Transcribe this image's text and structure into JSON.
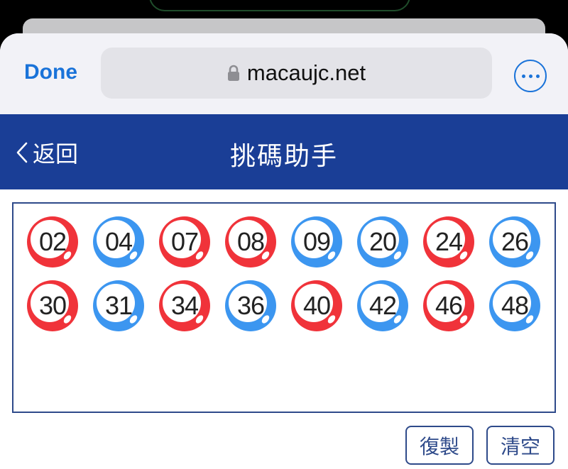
{
  "browser": {
    "done_label": "Done",
    "url": "macaujc.net",
    "lock_icon": "lock-icon",
    "more_icon": "ellipsis-circle-icon",
    "accent": "#1a73d9"
  },
  "nav": {
    "back_label": "返回",
    "back_icon": "chevron-left-icon",
    "title": "挑碼助手",
    "color": "#1a3e96"
  },
  "colors": {
    "red": "#f0333a",
    "blue": "#3c96f0"
  },
  "balls": [
    {
      "num": "02",
      "color": "red"
    },
    {
      "num": "04",
      "color": "blue"
    },
    {
      "num": "07",
      "color": "red"
    },
    {
      "num": "08",
      "color": "red"
    },
    {
      "num": "09",
      "color": "blue"
    },
    {
      "num": "20",
      "color": "blue"
    },
    {
      "num": "24",
      "color": "red"
    },
    {
      "num": "26",
      "color": "blue"
    },
    {
      "num": "30",
      "color": "red"
    },
    {
      "num": "31",
      "color": "blue"
    },
    {
      "num": "34",
      "color": "red"
    },
    {
      "num": "36",
      "color": "blue"
    },
    {
      "num": "40",
      "color": "red"
    },
    {
      "num": "42",
      "color": "blue"
    },
    {
      "num": "46",
      "color": "red"
    },
    {
      "num": "48",
      "color": "blue"
    }
  ],
  "actions": {
    "copy_label": "復製",
    "clear_label": "清空"
  }
}
